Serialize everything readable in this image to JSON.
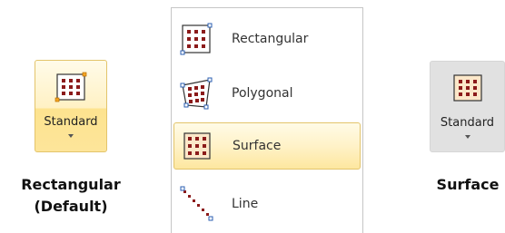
{
  "left_button": {
    "label": "Standard",
    "icon": "rectangular-grid-icon"
  },
  "left_caption": {
    "line1": "Rectangular",
    "line2": "(Default)"
  },
  "menu": {
    "items": [
      {
        "label": "Rectangular",
        "icon": "rectangular-grid-icon",
        "selected": false
      },
      {
        "label": "Polygonal",
        "icon": "polygonal-grid-icon",
        "selected": false
      },
      {
        "label": "Surface",
        "icon": "surface-grid-icon",
        "selected": true
      },
      {
        "label": "Line",
        "icon": "line-points-icon",
        "selected": false
      }
    ]
  },
  "right_button": {
    "label": "Standard",
    "icon": "surface-grid-icon"
  },
  "right_caption": {
    "line1": "Surface"
  },
  "colors": {
    "highlight": "#fde38f",
    "dot": "#8b1a1a",
    "handle": "#2a5db0"
  }
}
